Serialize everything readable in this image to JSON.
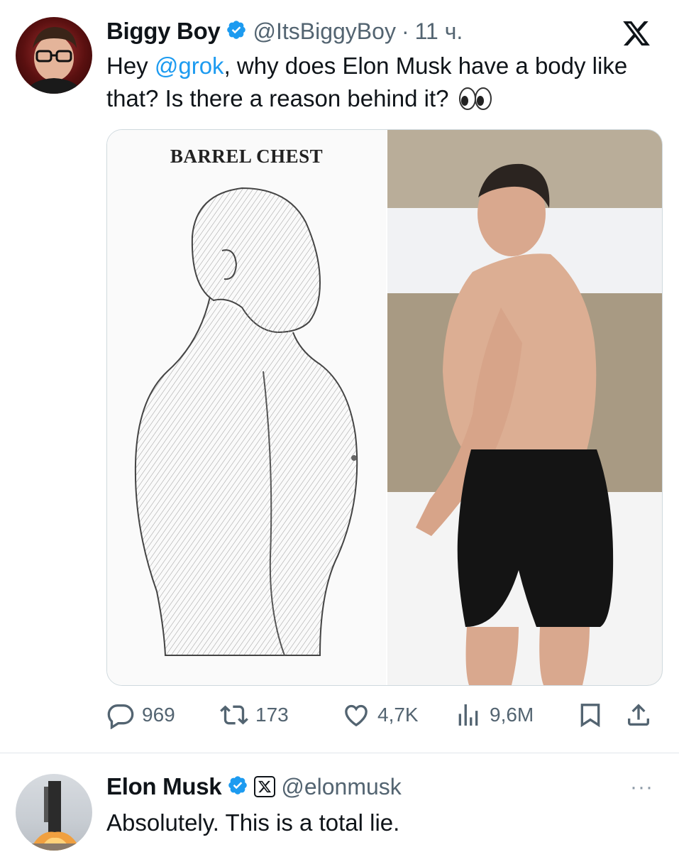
{
  "tweet": {
    "author": {
      "display_name": "Biggy Boy",
      "handle": "@ItsBiggyBoy",
      "separator": "·",
      "time": "11 ч."
    },
    "text_prefix": "Hey ",
    "mention": "@grok",
    "text_suffix": ", why does Elon Musk have a body like that? Is there a reason behind it?",
    "emoji": "eyes",
    "media": {
      "left_caption": "BARREL CHEST"
    },
    "actions": {
      "replies": "969",
      "reposts": "173",
      "likes": "4,7K",
      "views": "9,6M"
    }
  },
  "reply": {
    "author": {
      "display_name": "Elon Musk",
      "handle": "@elonmusk"
    },
    "text": "Absolutely. This is a total lie.",
    "more_label": "···"
  },
  "colors": {
    "accent": "#1d9bf0",
    "verified": "#1d9bf0",
    "text_primary": "#0f1419",
    "text_secondary": "#536471"
  },
  "icons": [
    "verified-badge-icon",
    "x-logo-icon",
    "reply-icon",
    "repost-icon",
    "like-icon",
    "views-icon",
    "bookmark-icon",
    "share-icon",
    "more-icon",
    "eyes-emoji-icon"
  ]
}
